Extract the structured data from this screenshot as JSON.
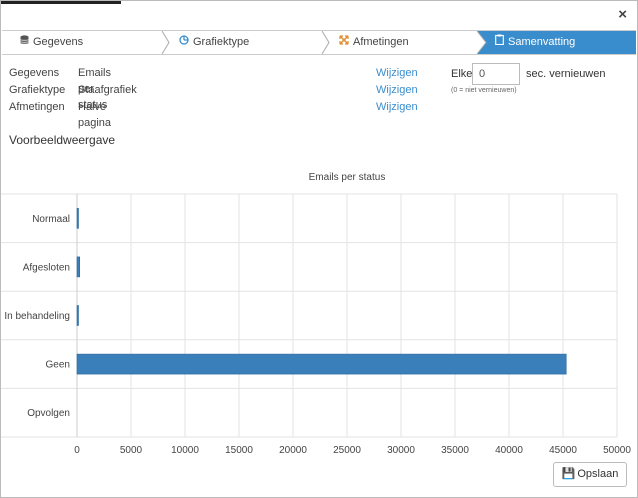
{
  "wizard": {
    "steps": [
      {
        "label": "Gegevens",
        "icon": "database-icon",
        "active": false
      },
      {
        "label": "Grafiektype",
        "icon": "pie-chart-icon",
        "active": false
      },
      {
        "label": "Afmetingen",
        "icon": "resize-arrows-icon",
        "active": false
      },
      {
        "label": "Samenvatting",
        "icon": "clipboard-icon",
        "active": true
      }
    ]
  },
  "summary": {
    "rows": [
      {
        "key": "Gegevens",
        "value": "Emails per status",
        "action": "Wijzigen"
      },
      {
        "key": "Grafiektype",
        "value": "Staafgrafiek",
        "action": "Wijzigen"
      },
      {
        "key": "Afmetingen",
        "value": "Halve pagina",
        "action": "Wijzigen"
      }
    ]
  },
  "refresh": {
    "prefix": "Elke",
    "value": "0",
    "suffix": "sec. vernieuwen",
    "hint": "(0 = niet vernieuwen)"
  },
  "preview_title": "Voorbeeldweergave",
  "save_label": "Opslaan",
  "colors": {
    "accent": "#3a8dcc",
    "bar": "#3a7fba",
    "save_icon": "#2e9e40"
  },
  "chart_data": {
    "type": "bar",
    "orientation": "horizontal",
    "title": "Emails per status",
    "categories": [
      "Normaal",
      "Afgesloten",
      "In behandeling",
      "Geen",
      "Opvolgen"
    ],
    "values": [
      60,
      250,
      100,
      45300,
      0
    ],
    "xlim": [
      0,
      50000
    ],
    "xticks": [
      0,
      5000,
      10000,
      15000,
      20000,
      25000,
      30000,
      35000,
      40000,
      45000,
      50000
    ],
    "grid": true
  }
}
